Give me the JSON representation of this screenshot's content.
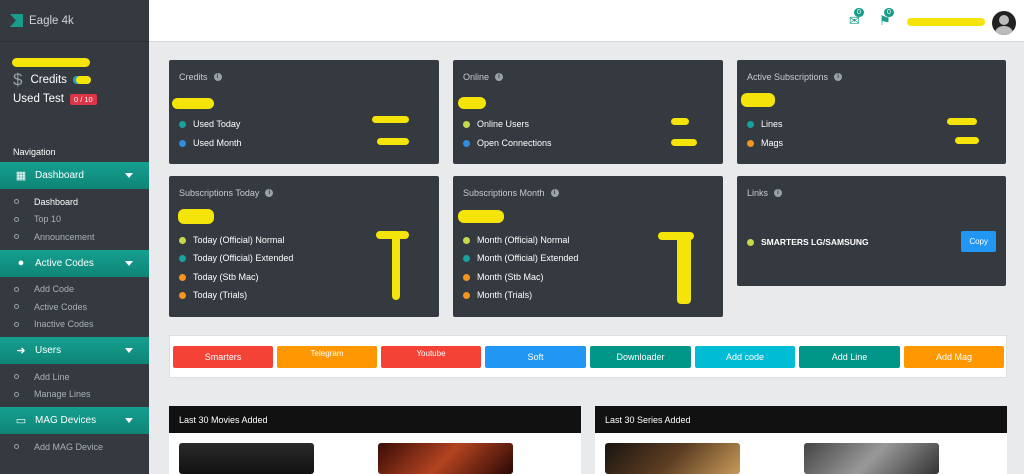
{
  "brand": {
    "name": "Eagle 4k"
  },
  "user": {
    "credits_label": "Credits",
    "used_label": "Used Test",
    "used_badge": "0 / 10"
  },
  "nav": {
    "title": "Navigation",
    "sections": [
      {
        "label": "Dashboard",
        "icon": "sitemap-icon",
        "items": [
          "Dashboard",
          "Top 10",
          "Announcement"
        ]
      },
      {
        "label": "Active Codes",
        "icon": "user-icon",
        "items": [
          "Add Code",
          "Active Codes",
          "Inactive Codes"
        ]
      },
      {
        "label": "Users",
        "icon": "sign-in-icon",
        "items": [
          "Add Line",
          "Manage Lines"
        ]
      },
      {
        "label": "MAG Devices",
        "icon": "tablet-icon",
        "items": [
          "Add MAG Device"
        ]
      }
    ]
  },
  "topbar": {
    "notif_count_1": "0",
    "notif_count_2": "0"
  },
  "cards": {
    "credits": {
      "title": "Credits",
      "items": [
        "Used Today",
        "Used Month"
      ]
    },
    "online": {
      "title": "Online",
      "items": [
        "Online Users",
        "Open Connections"
      ]
    },
    "active_subs": {
      "title": "Active Subscriptions",
      "items": [
        "Lines",
        "Mags"
      ]
    },
    "subs_today": {
      "title": "Subscriptions Today",
      "items": [
        "Today (Official) Normal",
        "Today (Official) Extended",
        "Today (Stb Mac)",
        "Today (Trials)"
      ]
    },
    "subs_month": {
      "title": "Subscriptions Month",
      "items": [
        "Month (Official) Normal",
        "Month (Official) Extended",
        "Month (Stb Mac)",
        "Month (Trials)"
      ]
    },
    "links": {
      "title": "Links",
      "item": "SMARTERS LG/SAMSUNG",
      "copy_label": "Copy"
    }
  },
  "quick_buttons": [
    {
      "label": "Smarters",
      "color": "#f44336"
    },
    {
      "label": "Telegram",
      "color": "#ff9800"
    },
    {
      "label": "Youtube",
      "color": "#f44336"
    },
    {
      "label": "Soft",
      "color": "#2196f3"
    },
    {
      "label": "Downloader",
      "color": "#009688"
    },
    {
      "label": "Add code",
      "color": "#00bcd4"
    },
    {
      "label": "Add Line",
      "color": "#009688"
    },
    {
      "label": "Add Mag",
      "color": "#ff9800"
    }
  ],
  "panels": {
    "movies_title": "Last 30 Movies Added",
    "series_title": "Last 30 Series Added"
  }
}
